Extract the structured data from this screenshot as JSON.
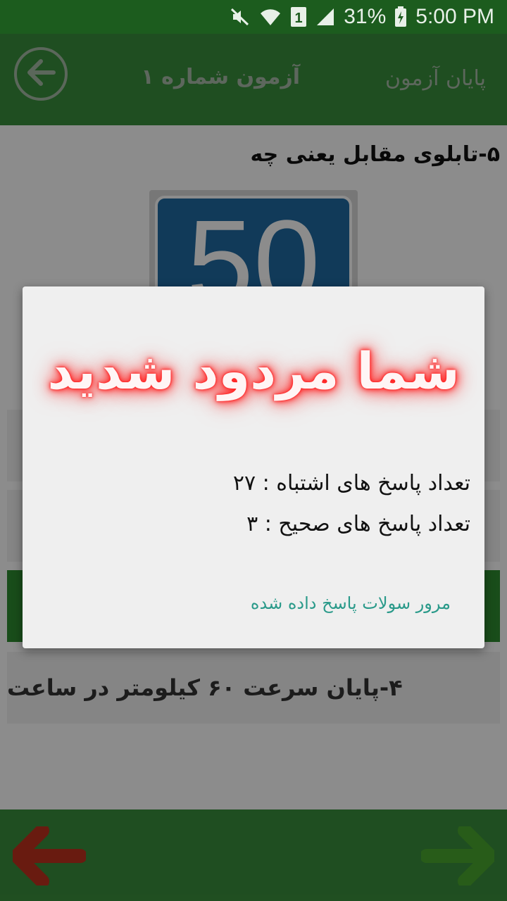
{
  "status_bar": {
    "battery_percent": "31%",
    "time": "5:00 PM",
    "sim_badge": "1",
    "icons": [
      "mute-icon",
      "wifi-icon",
      "sim-icon",
      "signal-icon",
      "battery-charging-icon"
    ]
  },
  "app_bar": {
    "title": "آزمون شماره ۱",
    "end_exam_label": "پایان آزمون",
    "back_icon": "back-arrow-icon"
  },
  "question": {
    "text": "۵-تابلوی مقابل یعنی چه",
    "sign_value": "50"
  },
  "options": [
    {
      "label": ""
    },
    {
      "label": ""
    },
    {
      "label": "",
      "selected": true
    },
    {
      "label": "۴-پایان سرعت ۶۰ کیلومتر در ساعت"
    }
  ],
  "dialog": {
    "title": "شما مردود شدید",
    "wrong_answers": "تعداد پاسخ های اشتباه : ۲۷",
    "correct_answers": "تعداد پاسخ های صحیح : ۳",
    "review_link": "مرور سولات پاسخ داده شده"
  },
  "bottom_nav": {
    "prev_icon": "arrow-left-red-icon",
    "next_icon": "arrow-right-green-icon"
  },
  "colors": {
    "status_bar": "#1c5c1e",
    "app_bar": "#3a8f3c",
    "selected_option": "#2f8d31",
    "fail_glow": "#ff2020",
    "link": "#2a9a8a",
    "sign_blue": "#1f6aa3"
  }
}
